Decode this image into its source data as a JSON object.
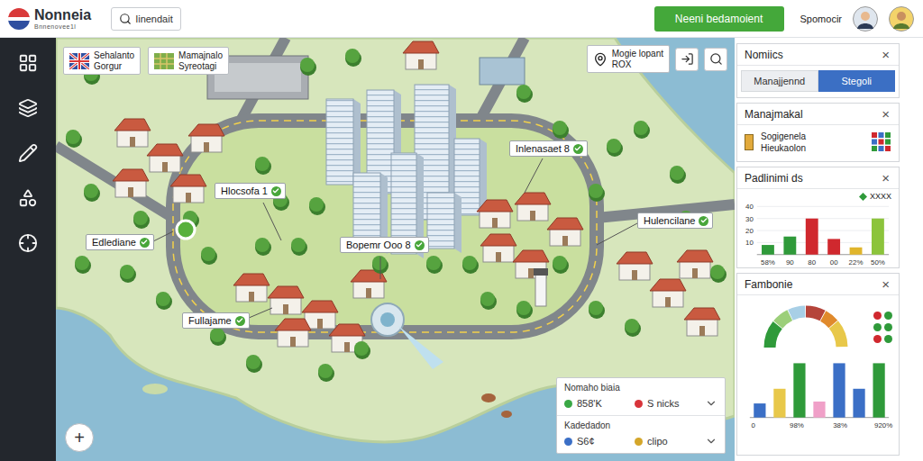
{
  "app": {
    "title": "Nonneia",
    "subtitle": "Bnnenovee1l"
  },
  "search": {
    "placeholder": "Iinendait"
  },
  "header": {
    "primary_button": "Neeni bedamoient",
    "user": "Spomocir"
  },
  "map": {
    "layer_chips": [
      {
        "line1": "Sehalanto",
        "line2": "Gorgur"
      },
      {
        "line1": "Mamajnalo",
        "line2": "Syreotagi"
      }
    ],
    "location_chip": {
      "line1": "Mogie lopant",
      "line2": "ROX"
    },
    "labels": [
      {
        "text": "Inlenasaet 8"
      },
      {
        "text": "Hlocsofa 1"
      },
      {
        "text": "Edlediane"
      },
      {
        "text": "Bopemr Ooo 8"
      },
      {
        "text": "Hulencilane"
      },
      {
        "text": "Fullajame"
      }
    ],
    "zoom_button": "+",
    "legend": {
      "groups": [
        {
          "title": "Nomaho biaia",
          "items": [
            {
              "label": "858'K",
              "color": "#3aa845"
            },
            {
              "label": "S nicks",
              "color": "#d8343a"
            }
          ]
        },
        {
          "title": "Kadedadon",
          "items": [
            {
              "label": "S6¢",
              "color": "#3b6fc6"
            },
            {
              "label": "clipo",
              "color": "#d4a62a"
            }
          ]
        }
      ]
    }
  },
  "panels": {
    "nomiics": {
      "title": "Nomiics",
      "close": "×",
      "tabs": [
        {
          "label": "Manajjennd",
          "selected": false
        },
        {
          "label": "Stegoli",
          "selected": true
        }
      ]
    },
    "manajmakal": {
      "title": "Manajmakal",
      "close": "×",
      "lines": [
        "Sogigenela",
        "Hieukaolon"
      ]
    },
    "padlinimi": {
      "title": "Padlinimi ds",
      "close": "×",
      "legend": "XXXX",
      "y_ticks": [
        "40",
        "30",
        "20",
        "10"
      ],
      "x_labels": [
        "58%",
        "90",
        "80",
        "00",
        "22%",
        "50%"
      ],
      "bars": [
        {
          "value": 8,
          "color": "#2f9a3a"
        },
        {
          "value": 15,
          "color": "#2f9a3a"
        },
        {
          "value": 30,
          "color": "#d0282e"
        },
        {
          "value": 13,
          "color": "#d0282e"
        },
        {
          "value": 6,
          "color": "#e0b52c"
        },
        {
          "value": 30,
          "color": "#8cc43c"
        }
      ]
    },
    "fambonie": {
      "title": "Fambonie",
      "close": "×",
      "gauge": [
        {
          "value": 22,
          "color": "#2f9a3a"
        },
        {
          "value": 14,
          "color": "#9ccf7a"
        },
        {
          "value": 14,
          "color": "#a8cfe6"
        },
        {
          "value": 16,
          "color": "#b5443a"
        },
        {
          "value": 12,
          "color": "#e08a2c"
        },
        {
          "value": 22,
          "color": "#e8c84a"
        }
      ],
      "legend_dots": [
        {
          "color": "#d0282e"
        },
        {
          "color": "#2f9a3a"
        },
        {
          "color": "#2f9a3a"
        },
        {
          "color": "#2f9a3a"
        },
        {
          "color": "#d0282e"
        },
        {
          "color": "#2f9a3a"
        }
      ],
      "x_labels": [
        "0",
        "98%",
        "38%",
        "920%"
      ],
      "bars": [
        {
          "value": 22,
          "color": "#3b6fc6"
        },
        {
          "value": 45,
          "color": "#e8c84a"
        },
        {
          "value": 85,
          "color": "#2f9a3a"
        },
        {
          "value": 25,
          "color": "#f0a0c8"
        },
        {
          "value": 85,
          "color": "#3b6fc6"
        },
        {
          "value": 45,
          "color": "#3b6fc6"
        },
        {
          "value": 85,
          "color": "#2f9a3a"
        }
      ]
    }
  }
}
